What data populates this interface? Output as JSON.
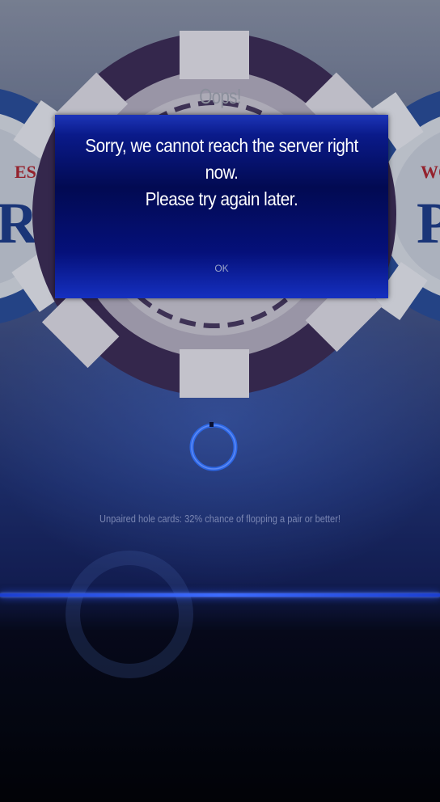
{
  "dialog": {
    "title": "Oops!",
    "message": "Sorry, we cannot reach the server right now.\nPlease try again later.",
    "ok_label": "OK"
  },
  "loading": {
    "tip": "Unpaired hole cards: 32% chance of flopping a pair or better!"
  },
  "background": {
    "left_chip_text": "ES\nR",
    "right_chip_text": "WO\nP"
  },
  "colors": {
    "dialog_blue": "#0a1a8a",
    "glow_blue": "#3d6cff",
    "chip_purple": "#4a3360",
    "spinner_blue": "#2d6cf0"
  },
  "icons": {
    "spinner": "loading-spinner-icon"
  }
}
